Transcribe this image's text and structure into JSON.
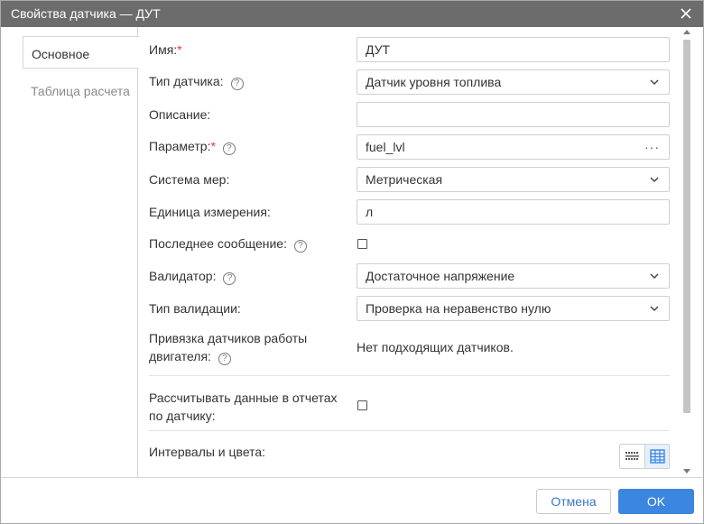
{
  "window": {
    "title": "Свойства датчика — ДУТ"
  },
  "tabs": [
    {
      "label": "Основное",
      "active": true
    },
    {
      "label": "Таблица расчета",
      "active": false
    }
  ],
  "form": {
    "name_label": "Имя:",
    "name_value": "ДУТ",
    "sensor_type_label": "Тип датчика:",
    "sensor_type_value": "Датчик уровня топлива",
    "description_label": "Описание:",
    "description_value": "",
    "parameter_label": "Параметр:",
    "parameter_value": "fuel_lvl",
    "parameter_more": "···",
    "unit_system_label": "Система мер:",
    "unit_system_value": "Метрическая",
    "unit_label": "Единица измерения:",
    "unit_value": "л",
    "last_message_label": "Последнее сообщение:",
    "last_message_checked": false,
    "validator_label": "Валидатор:",
    "validator_value": "Достаточное напряжение",
    "validation_type_label": "Тип валидации:",
    "validation_type_value": "Проверка на неравенство нулю",
    "engine_binding_label_1": "Привязка датчиков работы",
    "engine_binding_label_2": "двигателя:",
    "engine_binding_value": "Нет подходящих датчиков.",
    "calc_reports_label_1": "Рассчитывать данные в отчетах",
    "calc_reports_label_2": "по датчику:",
    "calc_reports_checked": false,
    "intervals_label": "Интервалы и цвета:"
  },
  "required_mark": "*",
  "help_glyph": "?",
  "footer": {
    "cancel_label": "Отмена",
    "ok_label": "OK"
  },
  "colors": {
    "titlebar": "#6c6c6c",
    "accent": "#3a86e0",
    "link": "#3a78c3",
    "required": "#e53935"
  }
}
